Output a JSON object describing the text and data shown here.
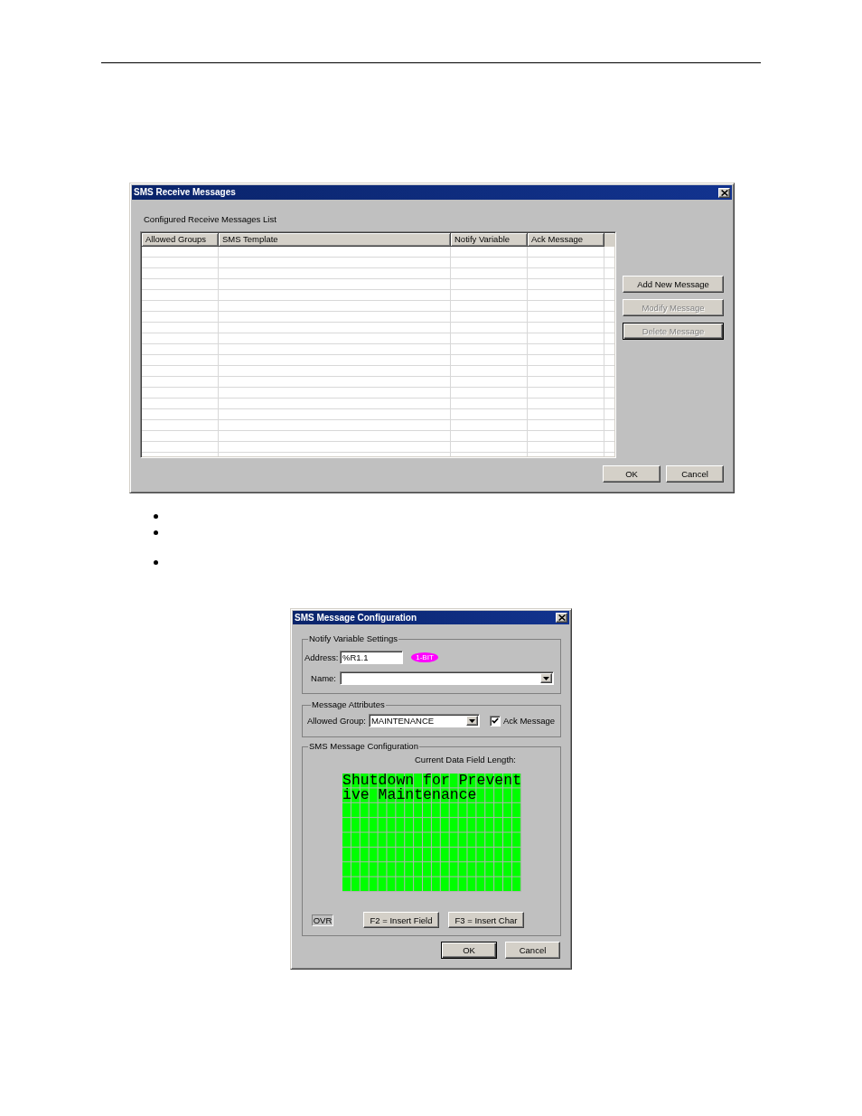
{
  "receive_dialog": {
    "title": "SMS Receive Messages",
    "list_label": "Configured Receive Messages List",
    "columns": [
      "Allowed Groups",
      "SMS Template",
      "Notify Variable",
      "Ack Message"
    ],
    "actions": [
      {
        "label": "Add New Message",
        "disabled": false,
        "default": false
      },
      {
        "label": "Modify Message",
        "disabled": true,
        "default": false
      },
      {
        "label": "Delete Message",
        "disabled": true,
        "default": true
      }
    ],
    "buttons": [
      {
        "label": "OK",
        "default": false
      },
      {
        "label": "Cancel",
        "default": false
      }
    ]
  },
  "config_dialog": {
    "title": "SMS Message Configuration",
    "notify_variable_settings": {
      "label": "Notify Variable Settings",
      "address_label": "Address:",
      "address": "%R1.1",
      "badge": "1-BIT",
      "name_label": "Name:"
    },
    "message_attributes": {
      "label": "Message Attributes",
      "allowed_group_label": "Allowed Group:",
      "allowed_group": "MAINTENANCE",
      "ack_message": {
        "label": "Ack Message",
        "checked": true
      }
    },
    "sms_message_configuration": {
      "label": "SMS Message Configuration",
      "length_label": "Current Data Field Length:",
      "message_lines": [
        "Shutdown for Prevent",
        "ive Maintenance"
      ],
      "mode": "OVR",
      "insert_buttons": [
        "F2 = Insert Field",
        "F3 = Insert Char"
      ]
    },
    "buttons": [
      {
        "label": "OK",
        "default": true
      },
      {
        "label": "Cancel",
        "default": false
      }
    ]
  }
}
